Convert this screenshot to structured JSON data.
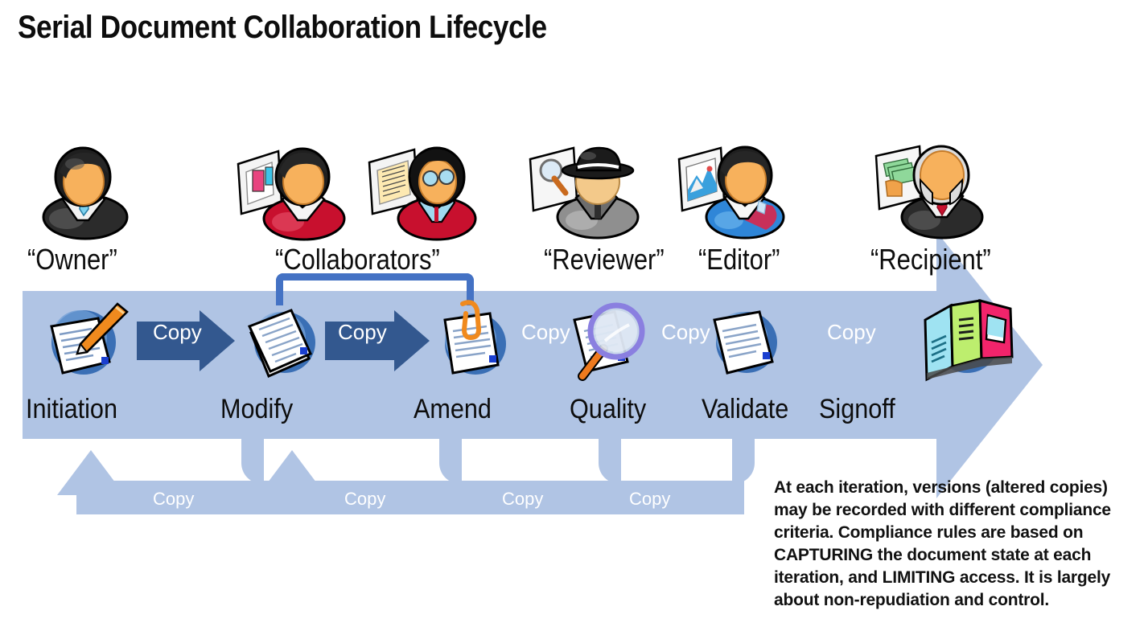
{
  "title": "Serial Document Collaboration Lifecycle",
  "roles": [
    {
      "label": "“Owner”",
      "icon": "businessman-dark-suit-icon"
    },
    {
      "label": "“Collaborators”",
      "icon": "collaborators-red-icon"
    },
    {
      "label": "“Reviewer”",
      "icon": "detective-magnifier-icon"
    },
    {
      "label": "“Editor”",
      "icon": "editor-blue-shirt-picture-icon"
    },
    {
      "label": "“Recipient”",
      "icon": "recipient-money-icon"
    }
  ],
  "stages": [
    {
      "label": "Initiation",
      "icon": "document-pen-icon"
    },
    {
      "label": "Modify",
      "icon": "document-stack-icon"
    },
    {
      "label": "Amend",
      "icon": "document-clip-icon"
    },
    {
      "label": "Quality",
      "icon": "document-magnifier-icon"
    },
    {
      "label": "Validate",
      "icon": "document-check-icon"
    },
    {
      "label": "Signoff",
      "icon": "open-brochure-icon"
    }
  ],
  "forward_copies": [
    {
      "label": "Copy",
      "style": "arrow"
    },
    {
      "label": "Copy",
      "style": "arrow"
    },
    {
      "label": "Copy",
      "style": "plain"
    },
    {
      "label": "Copy",
      "style": "plain"
    },
    {
      "label": "Copy",
      "style": "plain"
    }
  ],
  "return_copies": [
    {
      "label": "Copy"
    },
    {
      "label": "Copy"
    },
    {
      "label": "Copy"
    },
    {
      "label": "Copy"
    }
  ],
  "note": {
    "text": "At each iteration, versions (altered copies) may be recorded with different compliance criteria. Compliance rules are based on CAPTURING the document state at each iteration, and LIMITING access. It is largely about non-repudiation and control."
  },
  "colors": {
    "band": "#b0c4e4",
    "arrow_dark": "#33588f",
    "bracket": "#4472c4",
    "text": "#0d0d0d",
    "copy_text": "#ffffff",
    "collaborator_red": "#c8102e",
    "suit_dark": "#3a3a3a",
    "editor_blue": "#2f86d8",
    "face_orange": "#f7b15c"
  }
}
